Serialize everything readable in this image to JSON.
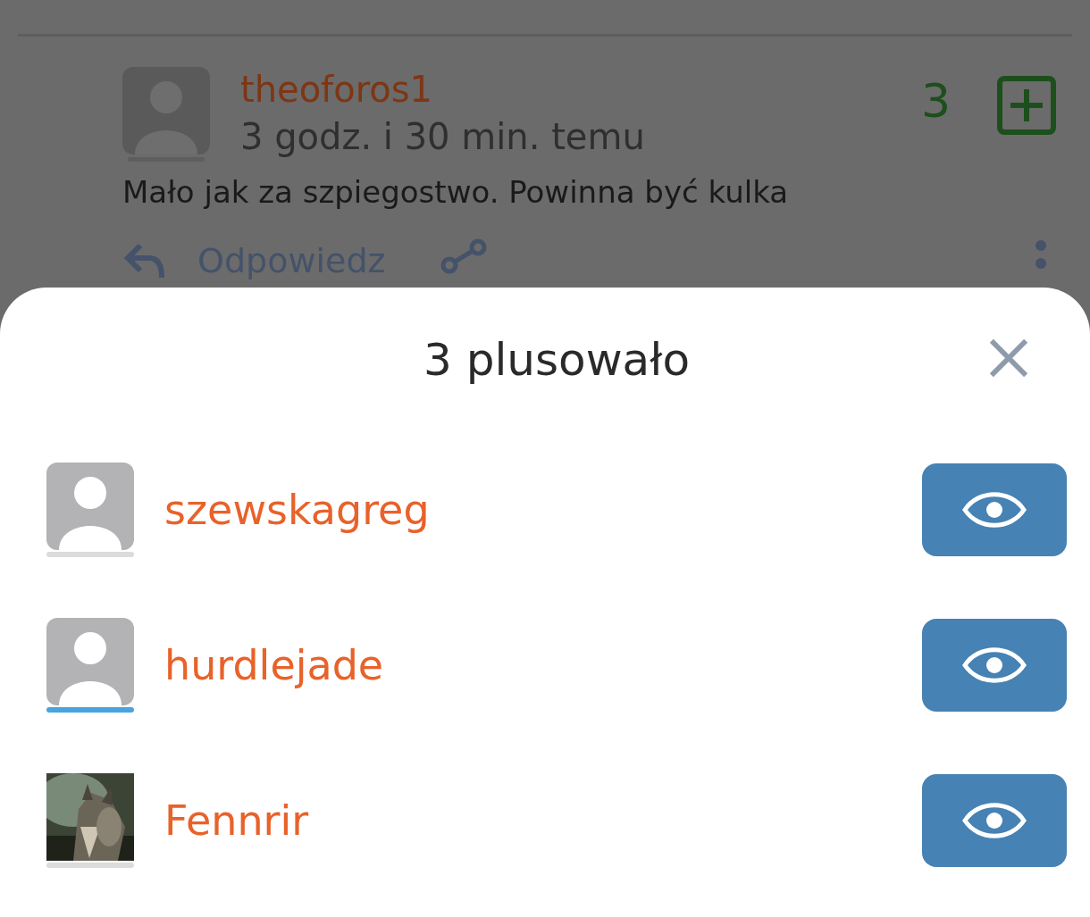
{
  "comment": {
    "author": "theoforos1",
    "time": "3 godz. i 30 min. temu",
    "score": "3",
    "text": "Mało jak za szpiegostwo. Powinna być kulka",
    "reply": "Odpowiedz"
  },
  "sheet": {
    "title": "3 plusowało",
    "users": [
      {
        "name": "szewskagreg",
        "kind": "default",
        "color": "#dcdcdc"
      },
      {
        "name": "hurdlejade",
        "kind": "default",
        "color": "#4aa3df"
      },
      {
        "name": "Fennrir",
        "kind": "picture",
        "color": "#dcdcdc"
      }
    ]
  }
}
